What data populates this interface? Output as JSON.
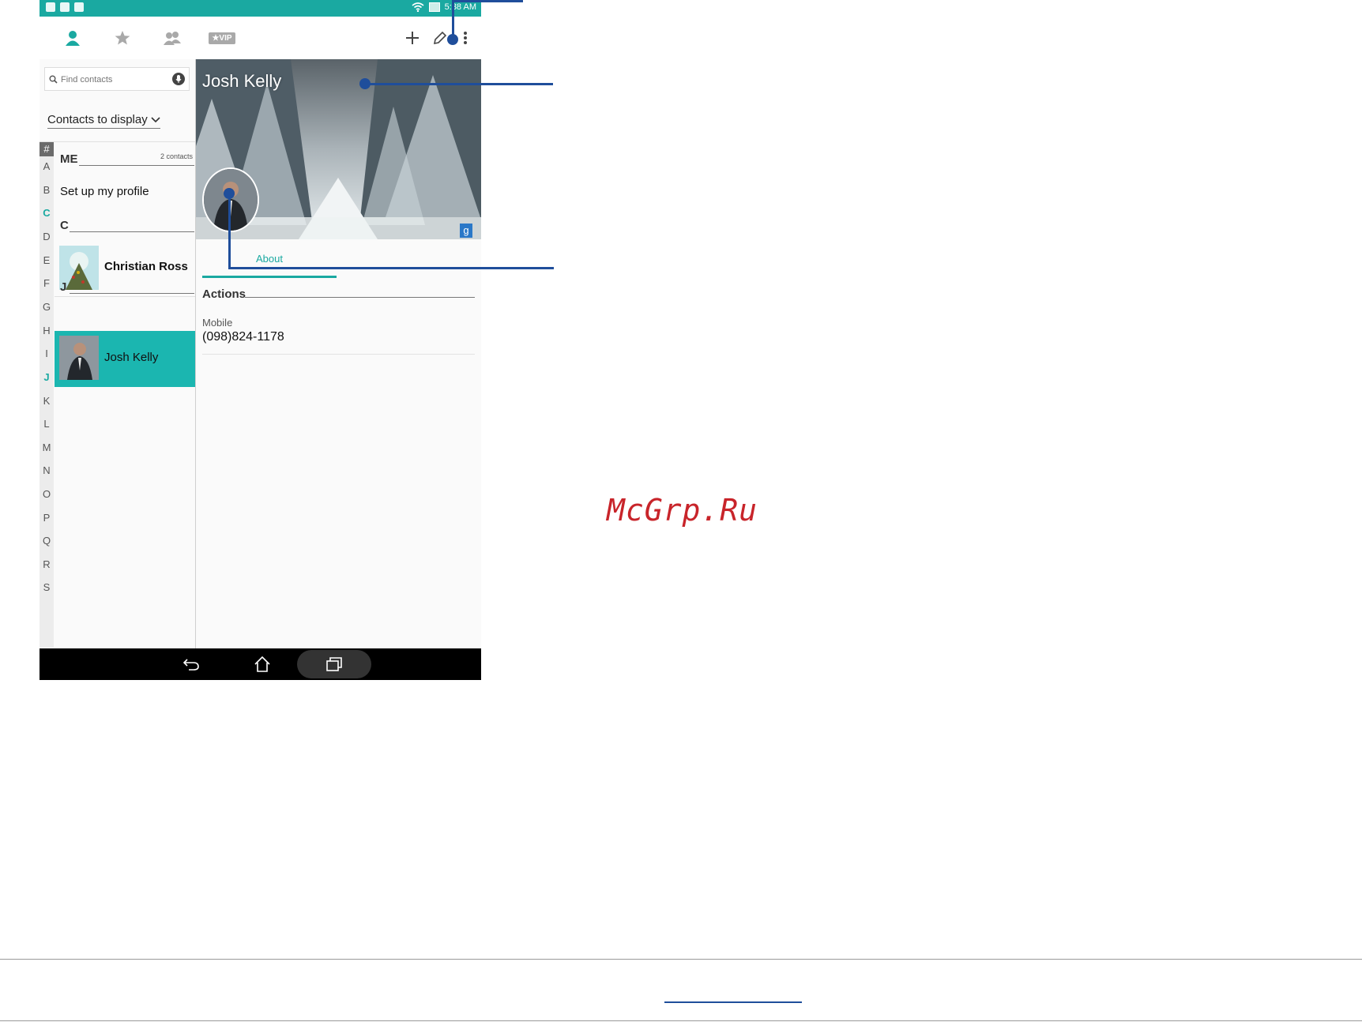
{
  "status_bar": {
    "time": "5:38 AM"
  },
  "toolbar": {
    "tabs": [
      {
        "icon": "contacts-person-icon",
        "active": true
      },
      {
        "icon": "favorites-star-icon"
      },
      {
        "icon": "groups-icon"
      },
      {
        "icon": "vip-icon",
        "label": "VIP"
      }
    ],
    "actions": [
      "add-icon",
      "edit-pencil-icon",
      "more-vert-icon"
    ]
  },
  "search": {
    "placeholder": "Find contacts"
  },
  "filter_label": "Contacts to display",
  "alphabet": [
    "#",
    "A",
    "B",
    "C",
    "D",
    "E",
    "F",
    "G",
    "H",
    "I",
    "J",
    "K",
    "L",
    "M",
    "N",
    "O",
    "P",
    "Q",
    "R",
    "S"
  ],
  "alphabet_highlight": [
    "C",
    "J"
  ],
  "sections": {
    "me": {
      "header": "ME",
      "count": "2 contacts",
      "item": "Set up my profile"
    },
    "c": {
      "header": "C",
      "item": "Christian Ross"
    },
    "j": {
      "header": "J",
      "item": "Josh Kelly"
    }
  },
  "detail": {
    "name": "Josh Kelly",
    "tab": "About",
    "actions_title": "Actions",
    "phone_label": "Mobile",
    "phone_number": "(098)824-1178"
  },
  "watermark": "McGrp.Ru",
  "colors": {
    "accent": "#1aa9a1",
    "selected_row": "#1bb6b0",
    "callout": "#1f4e9b"
  }
}
